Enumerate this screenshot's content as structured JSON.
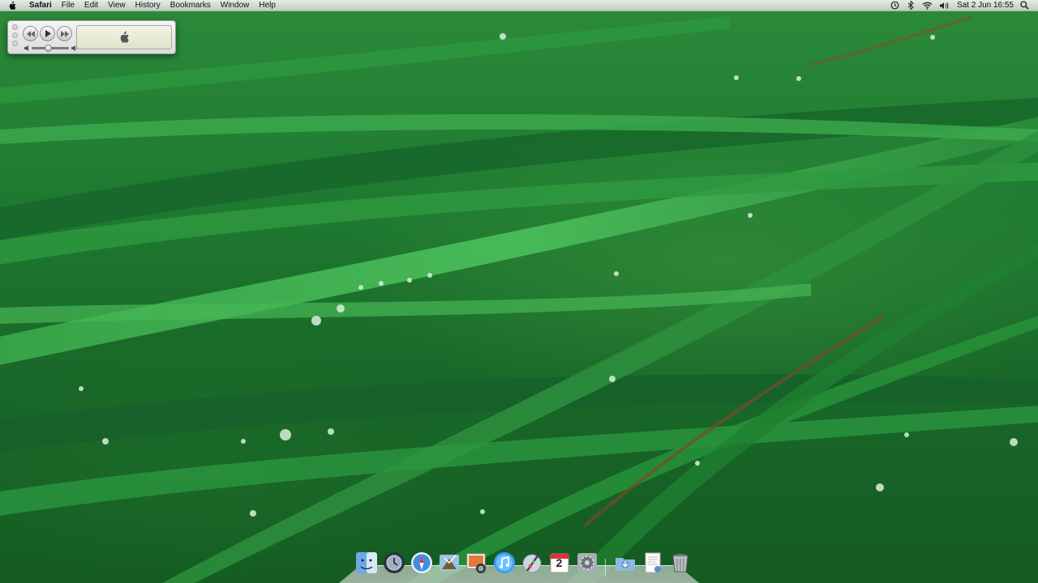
{
  "menubar": {
    "app_name": "Safari",
    "menus": [
      "File",
      "Edit",
      "View",
      "History",
      "Bookmarks",
      "Window",
      "Help"
    ],
    "clock": "Sat 2 Jun  16:55",
    "status_icons": [
      "time-machine-icon",
      "bluetooth-icon",
      "wifi-icon",
      "volume-icon"
    ]
  },
  "miniplayer": {
    "controls": [
      "previous-icon",
      "play-icon",
      "next-icon"
    ],
    "volume_level": 0.45
  },
  "dock": {
    "apps": [
      "Finder",
      "Time Machine",
      "Safari",
      "Mail",
      "iPhoto",
      "iTunes",
      "iWork",
      "iCal",
      "System Preferences"
    ],
    "calendar_day": "2",
    "others": [
      "Downloads",
      "Documents",
      "Trash"
    ]
  },
  "colors": {
    "menubar_bg": "#e6e8e6",
    "wallpaper_green": "#1e7a30"
  }
}
